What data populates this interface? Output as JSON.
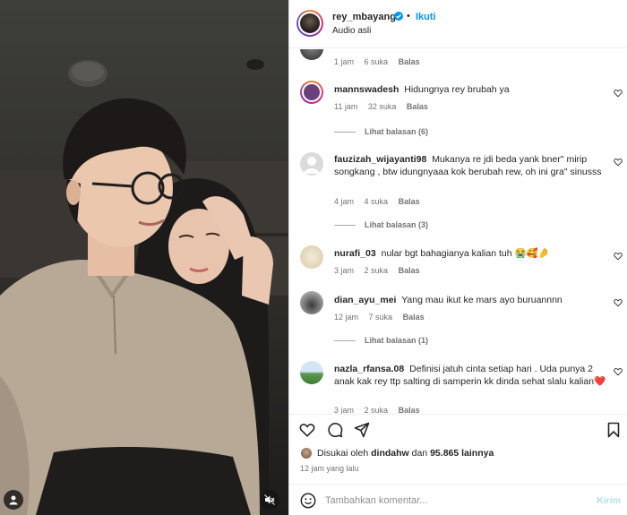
{
  "header": {
    "username": "rey_mbayang",
    "separator": "•",
    "follow_label": "Ikuti",
    "audio_label": "Audio asli"
  },
  "comments": [
    {
      "username": "",
      "text": "",
      "time": "1 jam",
      "likes": "6 suka",
      "reply_label": "Balas",
      "view_replies": ""
    },
    {
      "username": "mannswadesh",
      "text": "Hidungnya rey brubah ya",
      "time": "11 jam",
      "likes": "32 suka",
      "reply_label": "Balas",
      "view_replies": "Lihat balasan (6)"
    },
    {
      "username": "fauzizah_wijayanti98",
      "text": "Mukanya re jdi beda yank bner\" mirip songkang , btw idungnyaaa kok berubah rew, oh ini gra\" sinusss",
      "time": "4 jam",
      "likes": "4 suka",
      "reply_label": "Balas",
      "view_replies": "Lihat balasan (3)"
    },
    {
      "username": "nurafi_03",
      "text": "nular bgt bahagianya kalian tuh 😭🥰🤌",
      "time": "3 jam",
      "likes": "2 suka",
      "reply_label": "Balas",
      "view_replies": ""
    },
    {
      "username": "dian_ayu_mei",
      "text": "Yang mau ikut ke mars ayo buruannnn",
      "time": "12 jam",
      "likes": "7 suka",
      "reply_label": "Balas",
      "view_replies": "Lihat balasan (1)"
    },
    {
      "username": "nazla_rfansa.08",
      "text": "Definisi jatuh cinta setiap hari . Uda punya 2 anak kak rey ttp salting di samperin kk dinda sehat slalu kalian❤️",
      "time": "3 jam",
      "likes": "2 suka",
      "reply_label": "Balas",
      "view_replies": ""
    }
  ],
  "likes": {
    "prefix": "Disukai oleh",
    "user": "dindahw",
    "connector": "dan",
    "count": "95.865 lainnya"
  },
  "posted": "12 jam yang lalu",
  "composer": {
    "placeholder": "Tambahkan komentar...",
    "post_label": "Kirim"
  },
  "colors": {
    "accent": "#0095f6",
    "post_disabled": "#b2dffc",
    "secondary_text": "#737373"
  }
}
